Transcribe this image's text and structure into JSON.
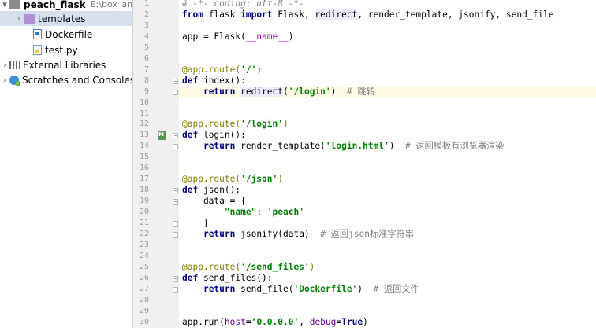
{
  "project_tree": {
    "root": {
      "name": "peach_flask",
      "path": "E:\\box_ange"
    },
    "items": [
      {
        "label": "templates",
        "icon": "folder-icon"
      },
      {
        "label": "Dockerfile",
        "icon": "dockerfile-icon"
      },
      {
        "label": "test.py",
        "icon": "python-file-icon"
      }
    ],
    "external": {
      "label": "External Libraries",
      "icon": "library-icon"
    },
    "scratches": {
      "label": "Scratches and Consoles",
      "icon": "scratches-icon"
    }
  },
  "editor": {
    "current_line": 9,
    "lines": [
      [
        {
          "t": "# -*- coding: utf-8 -*-",
          "c": "com"
        }
      ],
      [
        {
          "t": "from",
          "c": "kw"
        },
        {
          "t": " flask ",
          "c": ""
        },
        {
          "t": "import",
          "c": "kw"
        },
        {
          "t": " Flask, ",
          "c": ""
        },
        {
          "t": "redirect",
          "c": "fnhl"
        },
        {
          "t": ", render_template, jsonify, send_file",
          "c": ""
        }
      ],
      [],
      [
        {
          "t": "app = Flask(",
          "c": ""
        },
        {
          "t": "__name__",
          "c": "magic"
        },
        {
          "t": ")",
          "c": ""
        }
      ],
      [],
      [],
      [
        {
          "t": "@app.route(",
          "c": "dec"
        },
        {
          "t": "'/'",
          "c": "str2"
        },
        {
          "t": ")",
          "c": "dec"
        }
      ],
      [
        {
          "t": "def",
          "c": "kw"
        },
        {
          "t": " index():",
          "c": ""
        }
      ],
      [
        {
          "t": "    ",
          "c": ""
        },
        {
          "t": "return",
          "c": "kw"
        },
        {
          "t": " ",
          "c": ""
        },
        {
          "t": "redirect",
          "c": "fnhl"
        },
        {
          "t": "(",
          "c": ""
        },
        {
          "t": "'/login'",
          "c": "str2"
        },
        {
          "t": ")  ",
          "c": ""
        },
        {
          "t": "# 跳转",
          "c": "cn"
        }
      ],
      [],
      [],
      [
        {
          "t": "@app.route(",
          "c": "dec"
        },
        {
          "t": "'/login'",
          "c": "str2"
        },
        {
          "t": ")",
          "c": "dec"
        }
      ],
      [
        {
          "t": "def",
          "c": "kw"
        },
        {
          "t": " login():",
          "c": ""
        }
      ],
      [
        {
          "t": "    ",
          "c": ""
        },
        {
          "t": "return",
          "c": "kw"
        },
        {
          "t": " render_template(",
          "c": ""
        },
        {
          "t": "'login.html'",
          "c": "str2"
        },
        {
          "t": ")  ",
          "c": ""
        },
        {
          "t": "# 返回模板有浏览器渲染",
          "c": "cn"
        }
      ],
      [],
      [],
      [
        {
          "t": "@app.route(",
          "c": "dec"
        },
        {
          "t": "'/json'",
          "c": "str2"
        },
        {
          "t": ")",
          "c": "dec"
        }
      ],
      [
        {
          "t": "def",
          "c": "kw"
        },
        {
          "t": " json():",
          "c": ""
        }
      ],
      [
        {
          "t": "    data = {",
          "c": ""
        }
      ],
      [
        {
          "t": "        ",
          "c": ""
        },
        {
          "t": "\"name\"",
          "c": "str2"
        },
        {
          "t": ": ",
          "c": ""
        },
        {
          "t": "'peach'",
          "c": "str2"
        }
      ],
      [
        {
          "t": "    }",
          "c": ""
        }
      ],
      [
        {
          "t": "    ",
          "c": ""
        },
        {
          "t": "return",
          "c": "kw"
        },
        {
          "t": " jsonify(data)  ",
          "c": ""
        },
        {
          "t": "# 返回json标准字符串",
          "c": "cn"
        }
      ],
      [],
      [],
      [
        {
          "t": "@app.route(",
          "c": "dec"
        },
        {
          "t": "'/send_files'",
          "c": "str2"
        },
        {
          "t": ")",
          "c": "dec"
        }
      ],
      [
        {
          "t": "def",
          "c": "kw"
        },
        {
          "t": " send_files():",
          "c": ""
        }
      ],
      [
        {
          "t": "    ",
          "c": ""
        },
        {
          "t": "return",
          "c": "kw"
        },
        {
          "t": " send_file(",
          "c": ""
        },
        {
          "t": "'Dockerfile'",
          "c": "str2"
        },
        {
          "t": ")  ",
          "c": ""
        },
        {
          "t": "# 返回文件",
          "c": "cn"
        }
      ],
      [],
      [],
      [
        {
          "t": "app.run(",
          "c": ""
        },
        {
          "t": "host",
          "c": "param"
        },
        {
          "t": "=",
          "c": ""
        },
        {
          "t": "'0.0.0.0'",
          "c": "str2"
        },
        {
          "t": ", ",
          "c": ""
        },
        {
          "t": "debug",
          "c": "param"
        },
        {
          "t": "=",
          "c": ""
        },
        {
          "t": "True",
          "c": "kw"
        },
        {
          "t": ")",
          "c": ""
        }
      ]
    ],
    "fold_open_lines": [
      8,
      13,
      18,
      19,
      26
    ],
    "fold_close_lines": [
      9,
      14,
      21,
      22,
      27
    ],
    "run_marker_line": 13
  }
}
